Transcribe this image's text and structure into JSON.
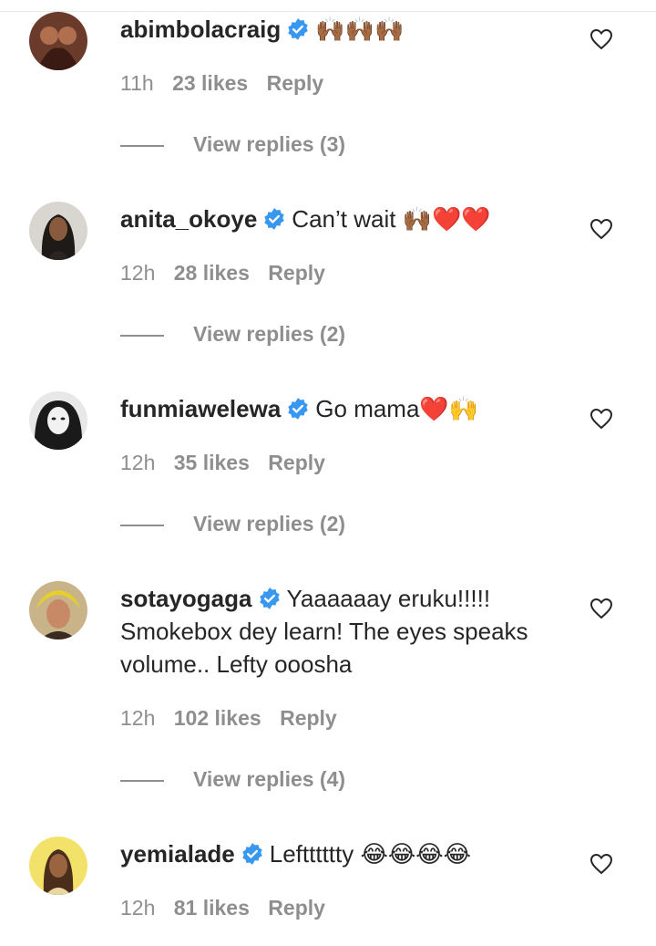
{
  "comments": [
    {
      "username": "abimbolacraig",
      "text": "🙌🏾🙌🏾🙌🏾",
      "time": "11h",
      "likes": "23 likes",
      "reply": "Reply",
      "view_replies": "View replies (3)"
    },
    {
      "username": "anita_okoye",
      "text": "Can’t wait 🙌🏾❤️❤️",
      "time": "12h",
      "likes": "28 likes",
      "reply": "Reply",
      "view_replies": "View replies (2)"
    },
    {
      "username": "funmiawelewa",
      "text": "Go mama❤️🙌",
      "time": "12h",
      "likes": "35 likes",
      "reply": "Reply",
      "view_replies": "View replies (2)"
    },
    {
      "username": "sotayogaga",
      "text": "Yaaaaaay eruku!!!!! Smokebox dey learn! The eyes speaks volume.. Lefty ooosha",
      "time": "12h",
      "likes": "102 likes",
      "reply": "Reply",
      "view_replies": "View replies (4)"
    },
    {
      "username": "yemialade",
      "text": "Leftttttty 😂😂😂😂",
      "time": "12h",
      "likes": "81 likes",
      "reply": "Reply"
    }
  ],
  "colors": {
    "text": "#262626",
    "secondary": "#8e8e8e",
    "verified_blue": "#3897f0"
  },
  "icons": {
    "verified": "verified-badge-icon",
    "like": "heart-outline-icon"
  }
}
